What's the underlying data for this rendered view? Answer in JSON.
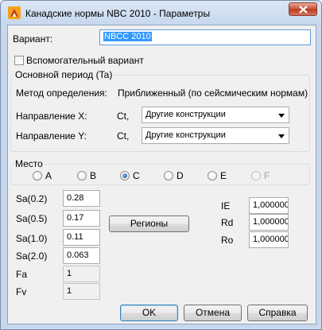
{
  "window": {
    "title": "Канадские нормы NBC 2010 - Параметры"
  },
  "variant": {
    "label": "Вариант:",
    "value": "NBCC 2010",
    "auxiliary_label": "Вспомогательный вариант",
    "auxiliary_checked": false
  },
  "period": {
    "group_title": "Основной период (Ta)",
    "method_label": "Метод определения:",
    "method_value": "Приближенный (по сейсмическим нормам)",
    "dir_x_label": "Направление X:",
    "dir_x_ct": "Ct,",
    "dir_x_value": "Другие конструкции",
    "dir_y_label": "Направление Y:",
    "dir_y_ct": "Ct,",
    "dir_y_value": "Другие конструкции"
  },
  "site": {
    "group_title": "Место",
    "options": [
      "A",
      "B",
      "C",
      "D",
      "E",
      "F"
    ],
    "selected": "C",
    "disabled": [
      "F"
    ]
  },
  "params": {
    "sa02_label": "Sa(0.2)",
    "sa02_value": "0.28",
    "sa05_label": "Sa(0.5)",
    "sa05_value": "0.17",
    "sa10_label": "Sa(1.0)",
    "sa10_value": "0.11",
    "sa20_label": "Sa(2.0)",
    "sa20_value": "0.063",
    "fa_label": "Fa",
    "fa_value": "1",
    "fv_label": "Fv",
    "fv_value": "1",
    "regions_button": "Регионы",
    "ie_label": "IE",
    "ie_value": "1,000000",
    "rd_label": "Rd",
    "rd_value": "1,000000",
    "ro_label": "Ro",
    "ro_value": "1,000000"
  },
  "buttons": {
    "ok": "OK",
    "cancel": "Отмена",
    "help": "Справка"
  },
  "colors": {
    "selection": "#3399ff",
    "close_button": "#c74d37",
    "dialog_background": "#f0f0f0"
  }
}
